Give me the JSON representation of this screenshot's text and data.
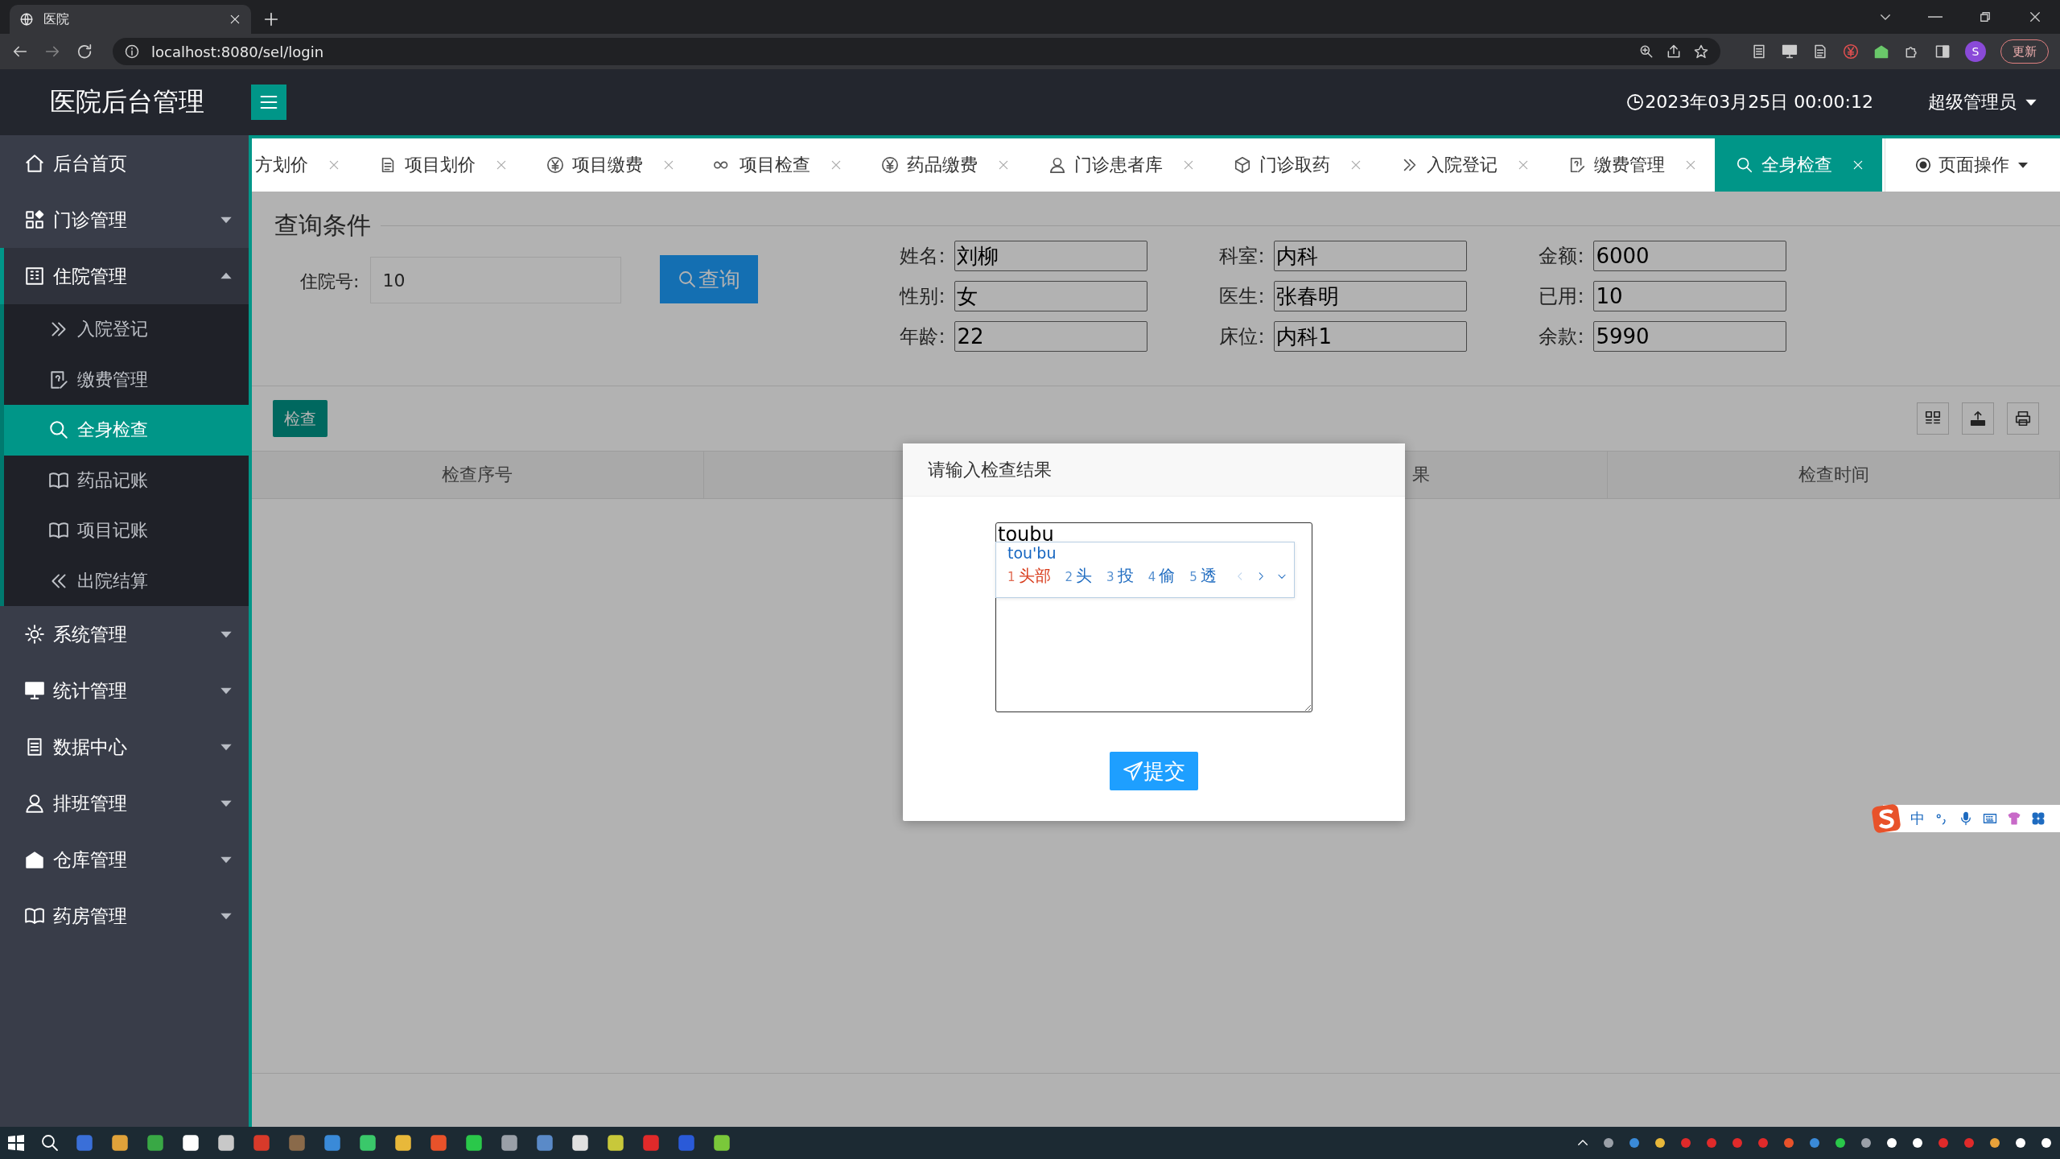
{
  "browser": {
    "tab_title": "医院",
    "url": "localhost:8080/sel/login",
    "profile": "S",
    "update_button": "更新"
  },
  "header": {
    "title": "医院后台管理",
    "datetime": "2023年03月25日 00:00:12",
    "user": "超级管理员"
  },
  "sidebar": {
    "items": [
      {
        "label": "后台首页",
        "kind": "link",
        "selected": false
      },
      {
        "label": "门诊管理",
        "kind": "group",
        "expanded": false,
        "selected": false
      },
      {
        "label": "住院管理",
        "kind": "group",
        "expanded": true,
        "selected": false,
        "children": [
          {
            "label": "入院登记",
            "selected": false
          },
          {
            "label": "缴费管理",
            "selected": false
          },
          {
            "label": "全身检查",
            "selected": true
          },
          {
            "label": "药品记账",
            "selected": false
          },
          {
            "label": "项目记账",
            "selected": false
          },
          {
            "label": "出院结算",
            "selected": false
          }
        ]
      },
      {
        "label": "系统管理",
        "kind": "group",
        "expanded": false,
        "selected": false
      },
      {
        "label": "统计管理",
        "kind": "group",
        "expanded": false,
        "selected": false
      },
      {
        "label": "数据中心",
        "kind": "group",
        "expanded": false,
        "selected": false
      },
      {
        "label": "排班管理",
        "kind": "group",
        "expanded": false,
        "selected": false
      },
      {
        "label": "仓库管理",
        "kind": "group",
        "expanded": false,
        "selected": false
      },
      {
        "label": "药房管理",
        "kind": "group",
        "expanded": false,
        "selected": false
      }
    ]
  },
  "tabs": [
    {
      "label": "方划价",
      "selected": false
    },
    {
      "label": "项目划价",
      "selected": false
    },
    {
      "label": "项目缴费",
      "selected": false
    },
    {
      "label": "项目检查",
      "selected": false
    },
    {
      "label": "药品缴费",
      "selected": false
    },
    {
      "label": "门诊患者库",
      "selected": false
    },
    {
      "label": "门诊取药",
      "selected": false
    },
    {
      "label": "入院登记",
      "selected": false
    },
    {
      "label": "缴费管理",
      "selected": false
    },
    {
      "label": "全身检查",
      "selected": true
    }
  ],
  "page_operations": "页面操作",
  "query": {
    "title": "查询条件",
    "label": "住院号:",
    "value": "10",
    "button": "查询"
  },
  "patient_fields": [
    {
      "label": "姓名:",
      "value": "刘柳"
    },
    {
      "label": "科室:",
      "value": "内科"
    },
    {
      "label": "金额:",
      "value": "6000"
    },
    {
      "label": "性别:",
      "value": "女"
    },
    {
      "label": "医生:",
      "value": "张春明"
    },
    {
      "label": "已用:",
      "value": "10"
    },
    {
      "label": "年龄:",
      "value": "22"
    },
    {
      "label": "床位:",
      "value": "内科1"
    },
    {
      "label": "余款:",
      "value": "5990"
    }
  ],
  "toolbar": {
    "button": "检查"
  },
  "table": {
    "columns": [
      {
        "label": "检查序号"
      },
      {},
      {
        "label": "果",
        "kind": "partial"
      },
      {
        "label": "检查时间"
      }
    ]
  },
  "dialog": {
    "title": "请输入检查结果",
    "value": "toubu",
    "button": "提交"
  },
  "ime": {
    "composition": "tou'bu",
    "candidates": [
      {
        "index": "1",
        "text": "头部",
        "selected": true
      },
      {
        "index": "2",
        "text": "头",
        "selected": false
      },
      {
        "index": "3",
        "text": "投",
        "selected": false
      },
      {
        "index": "4",
        "text": "偷",
        "selected": false
      },
      {
        "index": "5",
        "text": "透",
        "selected": false
      }
    ],
    "status_mode": "中"
  }
}
